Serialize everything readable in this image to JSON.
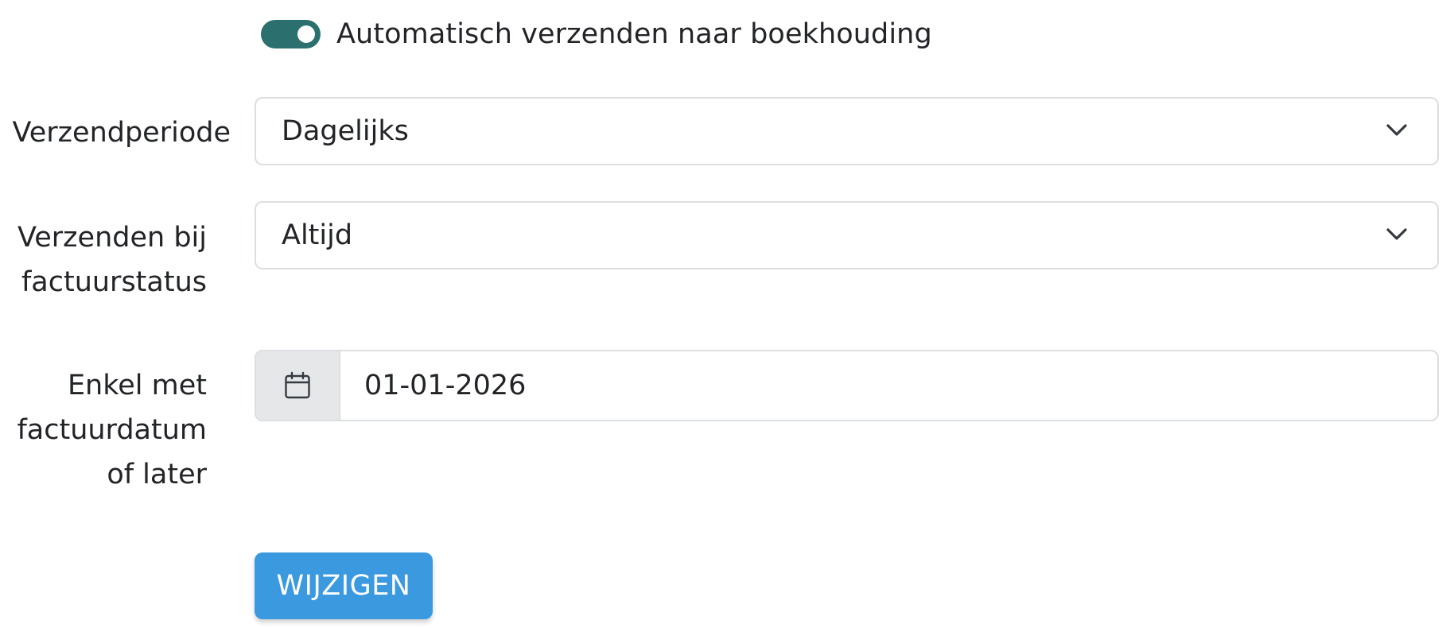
{
  "auto_send": {
    "enabled": true,
    "label": "Automatisch verzenden naar boekhouding"
  },
  "send_period": {
    "label": "Verzendperiode",
    "selected": "Dagelijks"
  },
  "invoice_status": {
    "label_line1": "Verzenden bij",
    "label_line2": "factuurstatus",
    "selected": "Altijd"
  },
  "invoice_date": {
    "label_line1": "Enkel met",
    "label_line2": "factuurdatum",
    "label_line3": "of later",
    "value": "01-01-2026",
    "icon": "calendar-icon"
  },
  "submit": {
    "label": "WIJZIGEN"
  },
  "colors": {
    "toggle_on": "#2b6f6e",
    "button": "#3b99e0",
    "addon_bg": "#e6e7e9",
    "border": "#dcdee2"
  }
}
